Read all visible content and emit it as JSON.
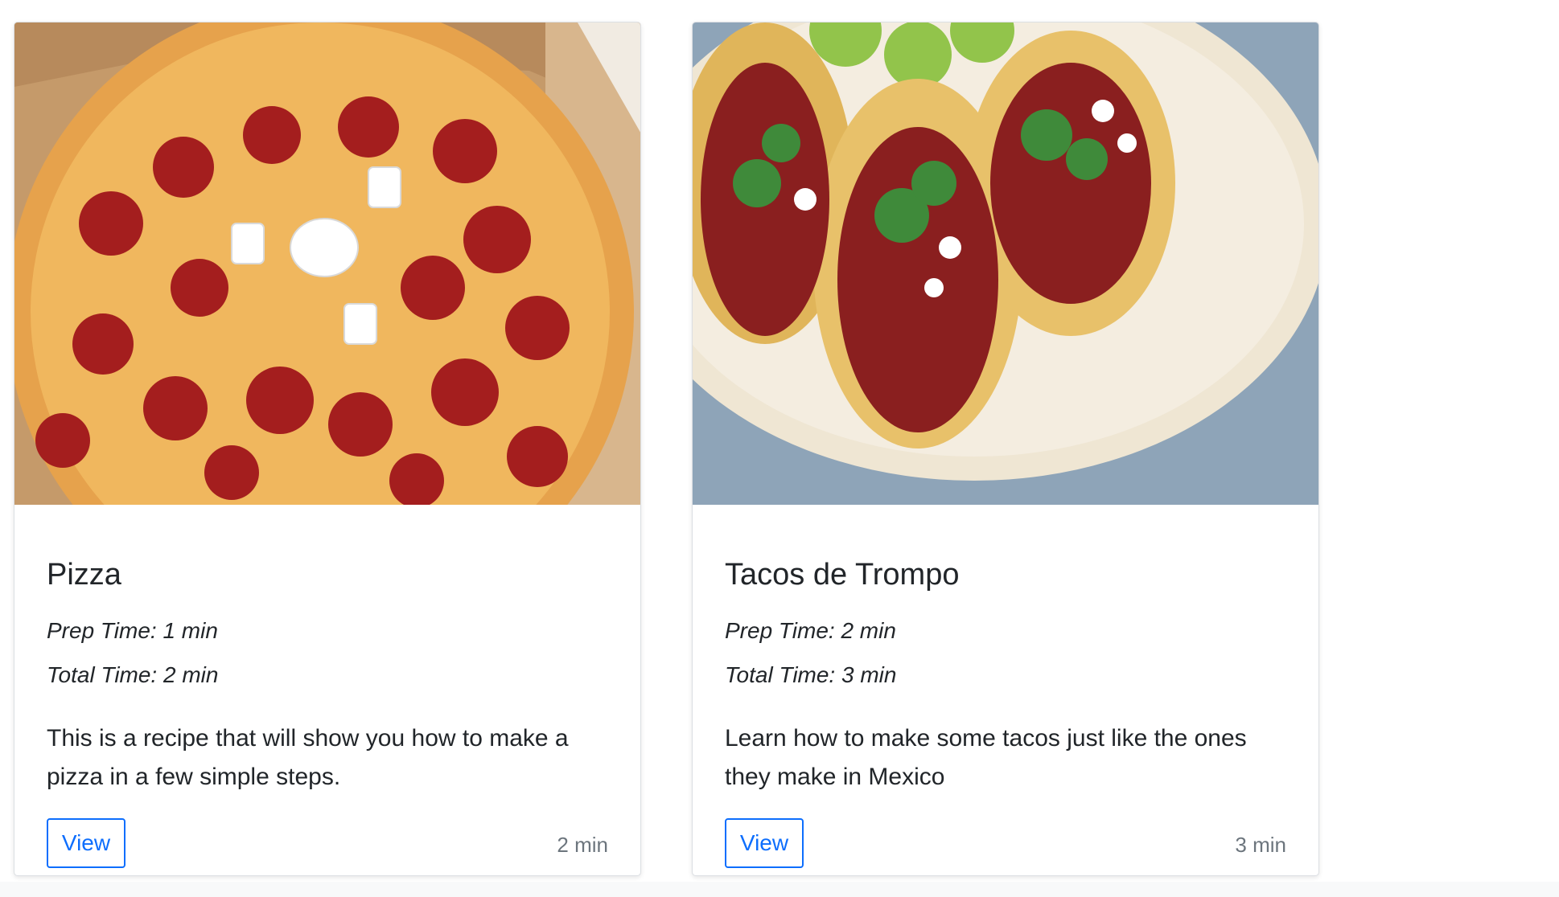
{
  "cards": [
    {
      "image_label": "pizza-photo",
      "title": "Pizza",
      "prep_time": "Prep Time: 1 min",
      "total_time": "Total Time: 2 min",
      "description": "This is a recipe that will show you how to make a pizza in a few simple steps.",
      "button_label": "View",
      "time_note": "2 min"
    },
    {
      "image_label": "tacos-photo",
      "title": "Tacos de Trompo",
      "prep_time": "Prep Time: 2 min",
      "total_time": "Total Time: 3 min",
      "description": "Learn how to make some tacos just like the ones they make in Mexico",
      "button_label": "View",
      "time_note": "3 min"
    }
  ],
  "colors": {
    "primary": "#0d6efd",
    "muted": "#6c757d",
    "text": "#212529"
  }
}
